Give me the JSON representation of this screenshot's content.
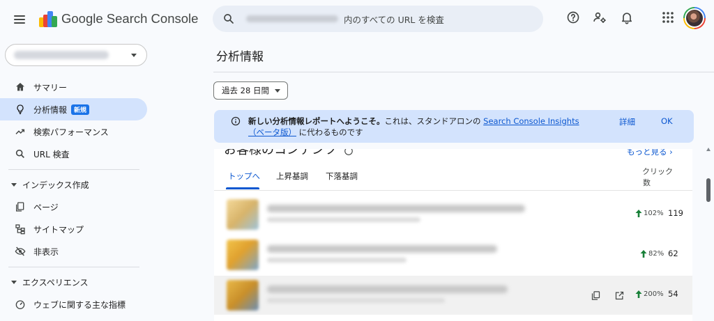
{
  "header": {
    "brand": "Google Search Console",
    "search": {
      "scope_text": "内のすべての URL を検査"
    }
  },
  "sidebar": {
    "summary": "サマリー",
    "insights": "分析情報",
    "new_badge": "新規",
    "performance": "検索パフォーマンス",
    "url_inspection": "URL 検査",
    "indexing_section": "インデックス作成",
    "pages": "ページ",
    "sitemaps": "サイトマップ",
    "removals": "非表示",
    "experience_section": "エクスペリエンス",
    "web_vitals": "ウェブに関する主な指標"
  },
  "main": {
    "page_title": "分析情報",
    "date_range": "過去 28 日間",
    "banner": {
      "lead": "新しい分析情報レポートへようこそ。",
      "body": "これは、スタンドアロンの",
      "link": "Search Console Insights（ベータ版）",
      "tail": "に代わるものです",
      "detail": "詳細",
      "ok": "OK"
    },
    "card": {
      "title": "お客様のコンテンツ",
      "more": "もっと見る",
      "tabs": [
        "トップへ",
        "上昇基調",
        "下落基調"
      ],
      "col_line1": "クリック",
      "col_line2": "数",
      "rows": [
        {
          "change": "102%",
          "clicks": "119"
        },
        {
          "change": "82%",
          "clicks": "62"
        },
        {
          "change": "200%",
          "clicks": "54"
        }
      ]
    }
  },
  "colors": {
    "accent": "#0b57d0",
    "active_nav": "#d3e3fd",
    "banner_bg": "#d3e3fd",
    "up_arrow": "#188038"
  }
}
